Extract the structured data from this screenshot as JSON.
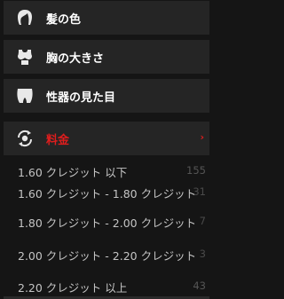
{
  "filters": {
    "categories": [
      {
        "label": "髪の色",
        "icon": "hair-icon"
      },
      {
        "label": "胸の大きさ",
        "icon": "torso-icon"
      },
      {
        "label": "性器の見た目",
        "icon": "hips-icon"
      },
      {
        "label": "料金",
        "icon": "money-exchange-icon",
        "active": true,
        "chevron": "›"
      }
    ],
    "price_options": [
      {
        "label": "1.60 クレジット 以下",
        "count": "155"
      },
      {
        "label": "1.60 クレジット - 1.80 クレジット",
        "count": "31"
      },
      {
        "label": "1.80 クレジット - 2.00 クレジット",
        "count": "7"
      },
      {
        "label": "2.00 クレジット - 2.20 クレジット",
        "count": "3"
      },
      {
        "label": "2.20 クレジット 以上",
        "count": "43"
      }
    ]
  },
  "colors": {
    "background": "#151515",
    "category_bg": "#252525",
    "accent_red": "#e01d1d",
    "option_text": "#c4c4c4"
  }
}
